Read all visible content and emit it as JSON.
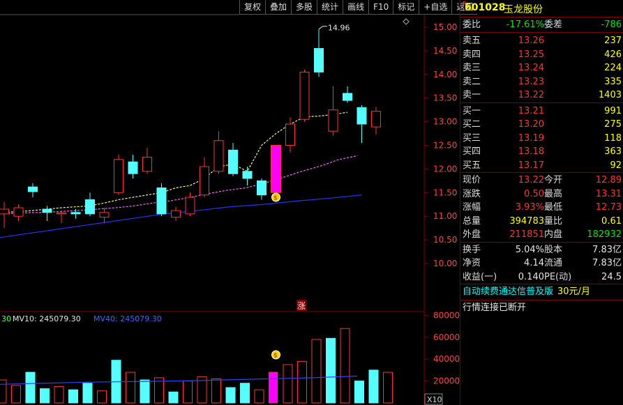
{
  "toolbar": {
    "buttons": [
      "复权",
      "叠加",
      "多股",
      "统计",
      "画线",
      "F10",
      "标记",
      "+自选",
      "返回"
    ]
  },
  "stock": {
    "badge_r": "R",
    "badge_num": "1000",
    "code": "601028",
    "name": "玉龙股份"
  },
  "quote": {
    "weibi": {
      "label": "委比",
      "value": "-17.61%"
    },
    "weicha": {
      "label": "委差",
      "value": "-786"
    },
    "asks": [
      {
        "label": "卖五",
        "price": "13.26",
        "vol": "237"
      },
      {
        "label": "卖四",
        "price": "13.25",
        "vol": "426"
      },
      {
        "label": "卖三",
        "price": "13.24",
        "vol": "224"
      },
      {
        "label": "卖二",
        "price": "13.23",
        "vol": "335"
      },
      {
        "label": "卖一",
        "price": "13.22",
        "vol": "1403"
      }
    ],
    "bids": [
      {
        "label": "买一",
        "price": "13.21",
        "vol": "991"
      },
      {
        "label": "买二",
        "price": "13.20",
        "vol": "275"
      },
      {
        "label": "买三",
        "price": "13.19",
        "vol": "118"
      },
      {
        "label": "买四",
        "price": "13.18",
        "vol": "363"
      },
      {
        "label": "买五",
        "price": "13.17",
        "vol": "92"
      }
    ],
    "stats": [
      {
        "l1": "现价",
        "v1": "13.22",
        "c1": "red",
        "l2": "今开",
        "v2": "12.89",
        "c2": "red"
      },
      {
        "l1": "涨跌",
        "v1": "0.50",
        "c1": "red",
        "l2": "最高",
        "v2": "13.31",
        "c2": "red"
      },
      {
        "l1": "涨幅",
        "v1": "3.93%",
        "c1": "red",
        "l2": "最低",
        "v2": "12.73",
        "c2": "red"
      },
      {
        "l1": "总量",
        "v1": "394783",
        "c1": "yellow",
        "l2": "量比",
        "v2": "0.61",
        "c2": "yellow"
      },
      {
        "l1": "外盘",
        "v1": "211851",
        "c1": "red",
        "l2": "内盘",
        "v2": "182932",
        "c2": "green"
      }
    ],
    "fund": [
      {
        "l1": "换手",
        "v1": "5.04%",
        "l2": "股本",
        "v2": "7.83亿"
      },
      {
        "l1": "净资",
        "v1": "4.14",
        "l2": "流通",
        "v2": "7.83亿"
      },
      {
        "l1": "收益(一)",
        "v1": "0.140",
        "l2": "PE(动)",
        "v2": "24.5"
      }
    ]
  },
  "promo": {
    "text": "自动续费通达信普及版",
    "price": "30元/月"
  },
  "status": {
    "text": "行情连接已断开"
  },
  "colors": {
    "up": "#ff3232",
    "down": "#54ffff",
    "ma5": "#ffff66",
    "ma10": "#ff66ff",
    "ma20": "#2233ff",
    "grid": "#800000"
  },
  "chart_data": {
    "type": "candlestick",
    "price_axis": {
      "ticks": [
        "15.00",
        "14.50",
        "14.00",
        "13.50",
        "13.00",
        "12.50",
        "12.00",
        "11.50",
        "11.00",
        "10.50",
        "10.00"
      ],
      "range": [
        9.6,
        15.3
      ]
    },
    "volume_axis": {
      "ticks": [
        "80000",
        "60000",
        "40000",
        "20000"
      ],
      "range": [
        0,
        90000
      ],
      "unit": "X10"
    },
    "max_label": "14.96",
    "limit_up_marker": "涨",
    "volume_legend": [
      {
        "text": "30",
        "color": "#54ff54"
      },
      {
        "text": "MV10: 245079.30",
        "color": "#e6e6e6"
      },
      {
        "text": "MV40: 245079.30",
        "color": "#2a6fff"
      }
    ],
    "candles": [
      {
        "o": 11.05,
        "c": 11.15,
        "h": 11.3,
        "l": 10.75
      },
      {
        "o": 11.0,
        "c": 11.18,
        "h": 11.25,
        "l": 10.9
      },
      {
        "o": 11.62,
        "c": 11.52,
        "h": 11.7,
        "l": 11.4
      },
      {
        "o": 11.15,
        "c": 11.08,
        "h": 11.22,
        "l": 10.9
      },
      {
        "o": 11.05,
        "c": 11.07,
        "h": 11.12,
        "l": 10.85
      },
      {
        "o": 11.08,
        "c": 11.05,
        "h": 11.15,
        "l": 10.95
      },
      {
        "o": 11.35,
        "c": 11.05,
        "h": 11.5,
        "l": 11.0
      },
      {
        "o": 10.98,
        "c": 11.08,
        "h": 11.18,
        "l": 10.85
      },
      {
        "o": 11.5,
        "c": 12.2,
        "h": 12.3,
        "l": 11.45
      },
      {
        "o": 12.15,
        "c": 11.9,
        "h": 12.3,
        "l": 11.8
      },
      {
        "o": 11.95,
        "c": 12.25,
        "h": 12.45,
        "l": 11.9
      },
      {
        "o": 11.6,
        "c": 11.05,
        "h": 11.7,
        "l": 11.0
      },
      {
        "o": 10.98,
        "c": 11.12,
        "h": 11.2,
        "l": 10.9
      },
      {
        "o": 11.05,
        "c": 11.4,
        "h": 11.5,
        "l": 11.0
      },
      {
        "o": 11.45,
        "c": 12.05,
        "h": 12.25,
        "l": 11.4
      },
      {
        "o": 11.95,
        "c": 12.6,
        "h": 12.8,
        "l": 11.9
      },
      {
        "o": 12.4,
        "c": 11.9,
        "h": 12.55,
        "l": 11.85
      },
      {
        "o": 11.95,
        "c": 11.8,
        "h": 12.05,
        "l": 11.65
      },
      {
        "o": 11.75,
        "c": 11.45,
        "h": 11.8,
        "l": 11.35
      },
      {
        "o": 11.5,
        "c": 12.5,
        "h": 12.5,
        "l": 11.5
      },
      {
        "o": 12.5,
        "c": 12.95,
        "h": 13.1,
        "l": 12.35
      },
      {
        "o": 13.05,
        "c": 14.05,
        "h": 14.1,
        "l": 13.0
      },
      {
        "o": 14.55,
        "c": 14.05,
        "h": 14.96,
        "l": 13.95
      },
      {
        "o": 12.8,
        "c": 13.25,
        "h": 13.75,
        "l": 12.7
      },
      {
        "o": 13.6,
        "c": 13.45,
        "h": 13.75,
        "l": 13.4
      },
      {
        "o": 13.3,
        "c": 12.95,
        "h": 13.35,
        "l": 12.55
      },
      {
        "o": 12.89,
        "c": 13.22,
        "h": 13.31,
        "l": 12.73
      }
    ],
    "volumes": [
      21000,
      16000,
      28000,
      13000,
      15000,
      12000,
      18000,
      11000,
      39000,
      28000,
      21000,
      23000,
      10000,
      20000,
      24000,
      22000,
      14000,
      18000,
      12000,
      28000,
      35000,
      38000,
      58000,
      59000,
      68000,
      20000,
      30000,
      28000
    ],
    "vol_kinds": [
      "u",
      "u",
      "d",
      "d",
      "u",
      "d",
      "d",
      "u",
      "d",
      "u",
      "d",
      "u",
      "d",
      "u",
      "u",
      "u",
      "d",
      "d",
      "u",
      "u",
      "u",
      "u",
      "u",
      "d",
      "u",
      "d",
      "d",
      "u"
    ],
    "ma5": [
      11.08,
      11.1,
      11.12,
      11.15,
      11.18,
      11.2,
      11.22,
      11.28,
      11.35,
      11.4,
      11.45,
      11.5,
      11.6,
      11.65,
      11.8,
      12.05,
      12.1,
      11.95,
      12.5,
      12.75,
      12.95,
      13.1,
      13.12,
      13.15,
      13.2
    ],
    "ma10": [
      11.05,
      11.07,
      11.08,
      11.1,
      11.12,
      11.15,
      11.18,
      11.22,
      11.28,
      11.33,
      11.4,
      11.48,
      11.55,
      11.6,
      11.7,
      11.82,
      11.95,
      12.06,
      12.2,
      12.28
    ],
    "ma60": [
      10.55,
      10.65,
      10.75,
      10.85,
      10.95,
      11.05,
      11.12,
      11.2,
      11.25,
      11.32,
      11.38,
      11.45
    ],
    "vol_ma": [
      17000,
      18000,
      19000,
      19500,
      20000,
      21000,
      22000,
      23000,
      24500
    ]
  }
}
